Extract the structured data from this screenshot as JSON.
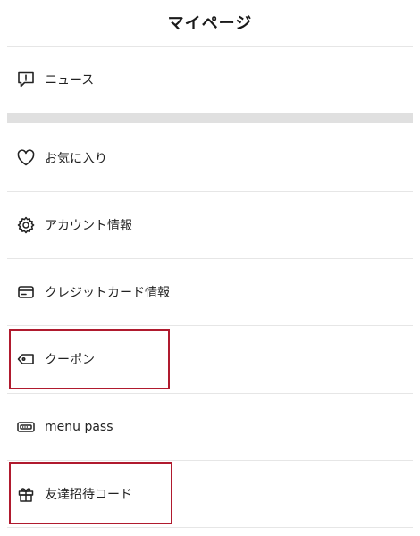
{
  "header": {
    "title": "マイページ"
  },
  "menu": {
    "news": {
      "label": "ニュース",
      "icon": "news-speech-bubble-icon"
    },
    "favorites": {
      "label": "お気に入り",
      "icon": "heart-icon"
    },
    "account": {
      "label": "アカウント情報",
      "icon": "gear-icon"
    },
    "credit_card": {
      "label": "クレジットカード情報",
      "icon": "credit-card-icon"
    },
    "coupon": {
      "label": "クーポン",
      "icon": "coupon-tag-icon"
    },
    "menu_pass": {
      "label": "menu pass",
      "icon": "ticket-pass-icon"
    },
    "invite_code": {
      "label": "友達招待コード",
      "icon": "gift-icon"
    }
  },
  "colors": {
    "highlight": "#b01a2e",
    "divider": "#e6e6e6",
    "section_gap": "#e0e0e0",
    "text": "#222222"
  }
}
